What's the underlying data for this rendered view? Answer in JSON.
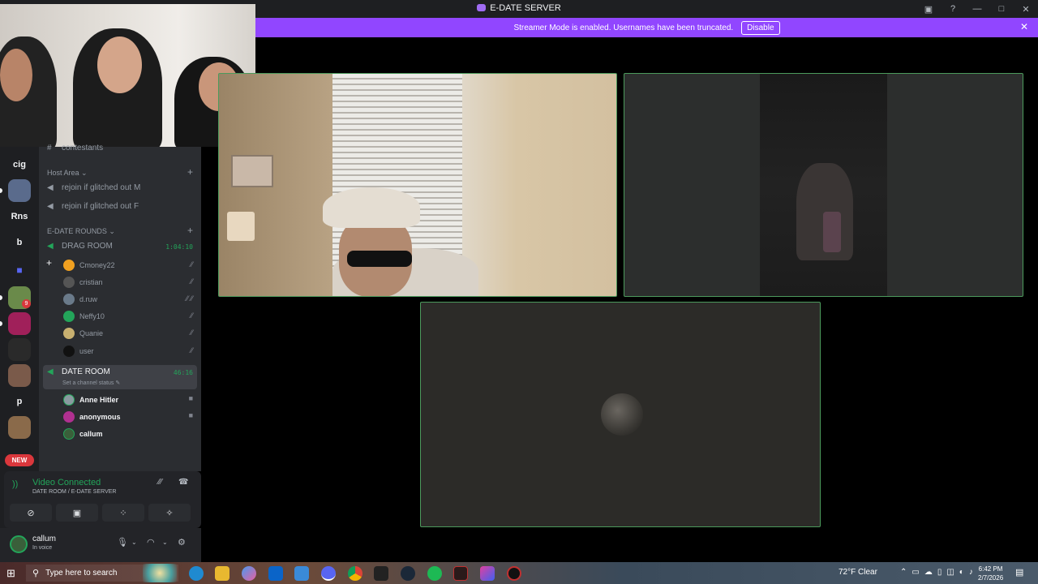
{
  "window": {
    "title": "E-DATE SERVER"
  },
  "banner": {
    "text": "Streamer Mode is enabled. Usernames have been truncated.",
    "disable_label": "Disable"
  },
  "rail": {
    "servers": [
      {
        "label": "cig"
      },
      {
        "label": "Rns"
      },
      {
        "label": "b"
      },
      {
        "label": "p"
      }
    ],
    "new_label": "NEW",
    "badge_count": "9"
  },
  "channels": {
    "top_partial": "contestants",
    "host_area": {
      "header": "Host Area",
      "items": [
        "rejoin if glitched out M",
        "rejoin if glitched out F"
      ]
    },
    "rounds": {
      "header": "E-DATE ROUNDS",
      "drag_room": {
        "name": "DRAG ROOM",
        "timer": "1:04:10",
        "users": [
          "Cmoney22",
          "cristian",
          "d.ruw",
          "Neffy10",
          "Quanie",
          "user"
        ]
      },
      "date_room": {
        "name": "DATE ROOM",
        "timer": "46:16",
        "status": "Set a channel status",
        "users": [
          "Anne Hitler",
          "anonymous",
          "callum"
        ]
      }
    }
  },
  "voice_panel": {
    "status": "Video Connected",
    "location": "DATE ROOM / E-DATE SERVER"
  },
  "user_panel": {
    "name": "callum",
    "status": "In voice"
  },
  "taskbar": {
    "search_placeholder": "Type here to search",
    "weather": "72°F  Clear",
    "time": "6:42 PM",
    "date": "2/7/2026"
  },
  "colors": {
    "accent": "#9146ff",
    "voice_green": "#23a55a",
    "danger": "#da373c"
  }
}
